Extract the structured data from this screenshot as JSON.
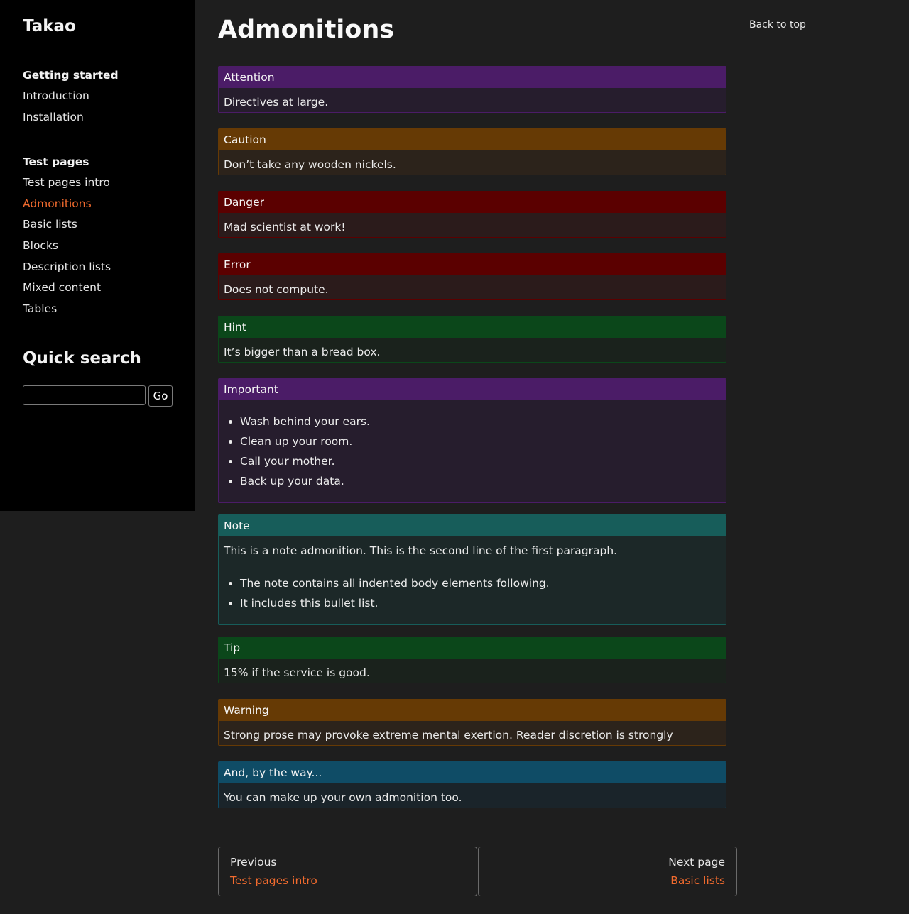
{
  "site": {
    "title": "Takao"
  },
  "sidebar": {
    "groups": [
      {
        "heading": "Getting started",
        "items": [
          "Introduction",
          "Installation"
        ]
      },
      {
        "heading": "Test pages",
        "items": [
          "Test pages intro",
          "Admonitions",
          "Basic lists",
          "Blocks",
          "Description lists",
          "Mixed content",
          "Tables"
        ]
      }
    ],
    "current_item": "Admonitions",
    "quick_search": {
      "title": "Quick search",
      "button_label": "Go",
      "value": ""
    }
  },
  "page": {
    "title": "Admonitions",
    "back_to_top": "Back to top"
  },
  "admonitions": [
    {
      "title": "Attention",
      "color": "purple",
      "text": "Directives at large."
    },
    {
      "title": "Caution",
      "color": "orange",
      "text": "Don’t take any wooden nickels."
    },
    {
      "title": "Danger",
      "color": "red",
      "text": "Mad scientist at work!"
    },
    {
      "title": "Error",
      "color": "red",
      "text": "Does not compute."
    },
    {
      "title": "Hint",
      "color": "green",
      "text": "It’s bigger than a bread box."
    },
    {
      "title": "Important",
      "color": "purple",
      "bullets": [
        "Wash behind your ears.",
        "Clean up your room.",
        "Call your mother.",
        "Back up your data."
      ]
    },
    {
      "title": "Note",
      "color": "teal",
      "text": "This is a note admonition. This is the second line of the first paragraph.",
      "bullets": [
        "The note contains all indented body elements following.",
        "It includes this bullet list."
      ]
    },
    {
      "title": "Tip",
      "color": "green",
      "text": "15% if the service is good."
    },
    {
      "title": "Warning",
      "color": "orange",
      "text": "Strong prose may provoke extreme mental exertion. Reader discretion is strongly advised."
    },
    {
      "title": "And, by the way...",
      "color": "blue",
      "text": "You can make up your own admonition too."
    }
  ],
  "pager": {
    "previous": {
      "label": "Previous",
      "link": "Test pages intro"
    },
    "next": {
      "label": "Next page",
      "link": "Basic lists"
    }
  },
  "colors": {
    "accent_link": "#f26b2e",
    "sidebar_bg": "#000000",
    "page_bg": "#1e1e1e",
    "purple": "#4b1c67",
    "orange": "#663a05",
    "red": "#5b0000",
    "green": "#0b471a",
    "teal": "#175d5a",
    "blue": "#0f4c66"
  }
}
